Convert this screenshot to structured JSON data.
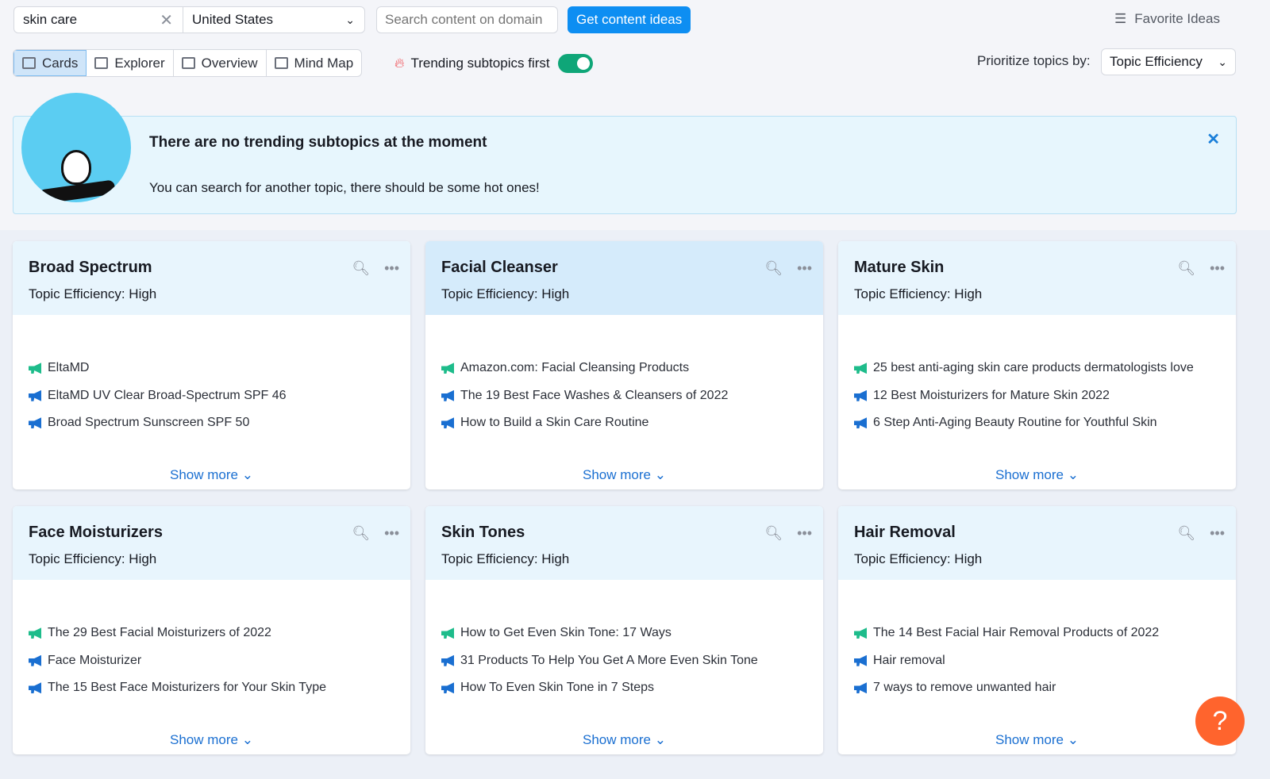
{
  "search": {
    "query": "skin care",
    "country": "United States",
    "domain_placeholder": "Search content on domain",
    "submit": "Get content ideas"
  },
  "favorites": "Favorite Ideas",
  "views": [
    {
      "label": "Cards",
      "active": true
    },
    {
      "label": "Explorer"
    },
    {
      "label": "Overview"
    },
    {
      "label": "Mind Map"
    }
  ],
  "trending": {
    "label": "Trending subtopics first",
    "on": true
  },
  "prioritize": {
    "label": "Prioritize topics by:",
    "value": "Topic Efficiency"
  },
  "banner": {
    "title": "There are no trending subtopics at the moment",
    "text": "You can search for another topic, there should be some hot ones!"
  },
  "colors": {
    "accent": "#0d8ef2",
    "green": "#1ebc8b",
    "blue": "#1a6fd1",
    "help": "#ff642d"
  },
  "cards": [
    {
      "title": "Broad Spectrum",
      "efficiency": "Topic Efficiency: High",
      "items": [
        "EltaMD",
        "EltaMD UV Clear Broad-Spectrum SPF 46",
        "Broad Spectrum Sunscreen SPF 50"
      ],
      "more": "Show more"
    },
    {
      "title": "Facial Cleanser",
      "efficiency": "Topic Efficiency: High",
      "items": [
        "Amazon.com: Facial Cleansing Products",
        "The 19 Best Face Washes & Cleansers of 2022",
        "How to Build a Skin Care Routine"
      ],
      "more": "Show more"
    },
    {
      "title": "Mature Skin",
      "efficiency": "Topic Efficiency: High",
      "items": [
        "25 best anti-aging skin care products dermatologists love",
        "12 Best Moisturizers for Mature Skin 2022",
        "6 Step Anti-Aging Beauty Routine for Youthful Skin"
      ],
      "more": "Show more"
    },
    {
      "title": "Face Moisturizers",
      "efficiency": "Topic Efficiency: High",
      "items": [
        "The 29 Best Facial Moisturizers of 2022",
        "Face Moisturizer",
        "The 15 Best Face Moisturizers for Your Skin Type"
      ],
      "more": "Show more"
    },
    {
      "title": "Skin Tones",
      "efficiency": "Topic Efficiency: High",
      "items": [
        "How to Get Even Skin Tone: 17 Ways",
        "31 Products To Help You Get A More Even Skin Tone",
        "How To Even Skin Tone in 7 Steps"
      ],
      "more": "Show more"
    },
    {
      "title": "Hair Removal",
      "efficiency": "Topic Efficiency: High",
      "items": [
        "The 14 Best Facial Hair Removal Products of 2022",
        "Hair removal",
        "7 ways to remove unwanted hair"
      ],
      "more": "Show more"
    }
  ],
  "help": "?"
}
